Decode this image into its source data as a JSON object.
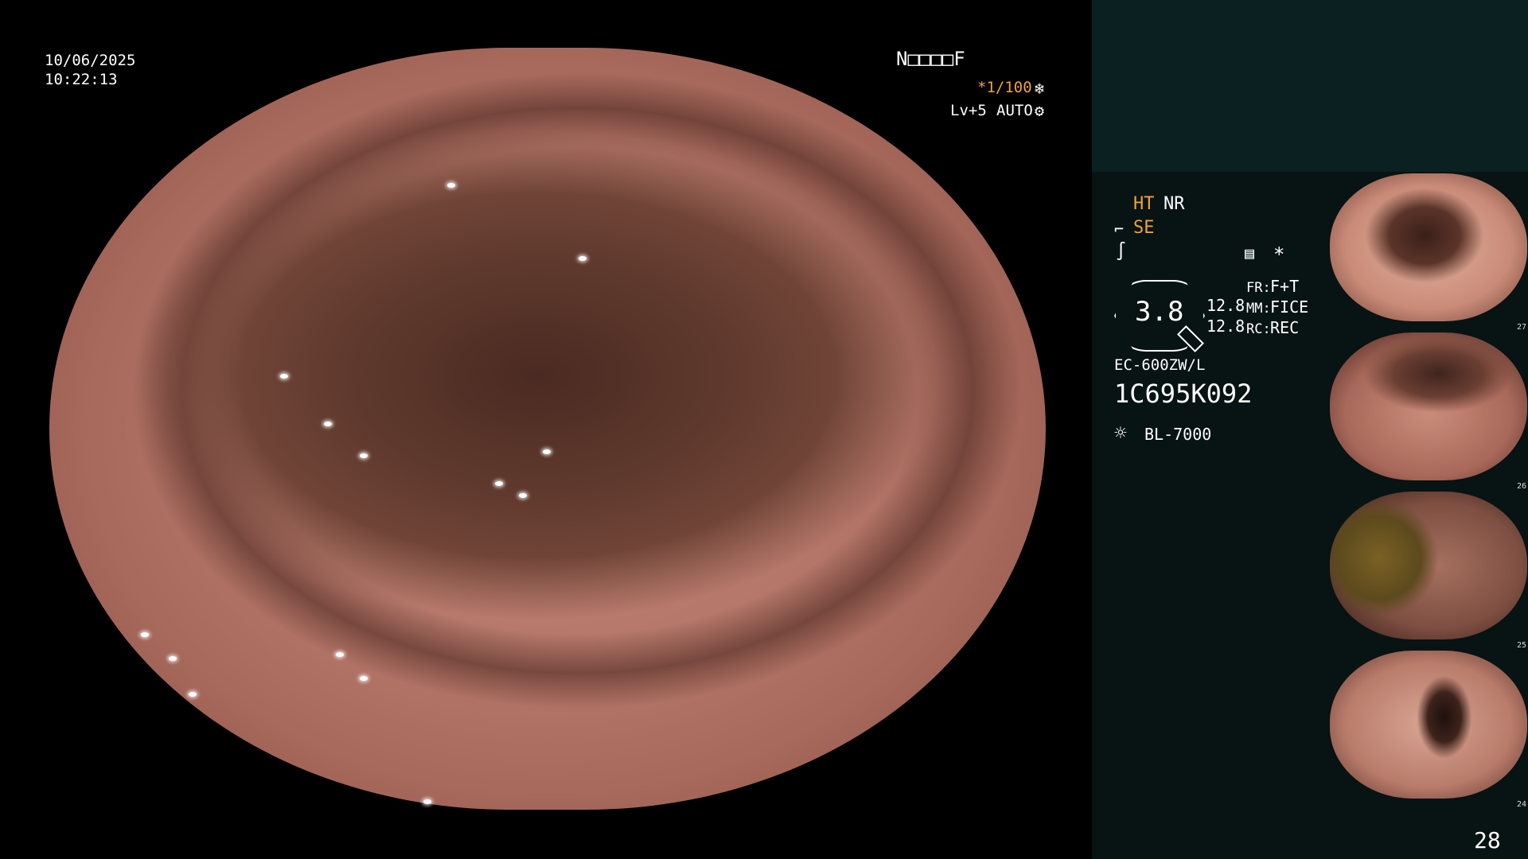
{
  "overlay": {
    "date": "10/06/2025",
    "time": "10:22:13",
    "patient_code": "N□□□□F",
    "shutter": "*1/100",
    "level": "Lv+5",
    "mode": "AUTO"
  },
  "panel": {
    "ht": "HT",
    "nr": "NR",
    "se": "SE",
    "scale_value": "3.8",
    "zoom1": "12.8",
    "zoom2": "12.8",
    "fr_label": "FR:",
    "fr_value": "F+T",
    "mm_label": "MM:",
    "mm_value": "FICE",
    "rc_label": "RC:",
    "rc_value": "REC",
    "scope_model": "EC-600ZW/L",
    "scope_serial": "1C695K092",
    "light_source": "BL-7000",
    "star": "*"
  },
  "thumbnails": [
    {
      "number": "27"
    },
    {
      "number": "26"
    },
    {
      "number": "25"
    },
    {
      "number": "24"
    }
  ],
  "image_counter": "28",
  "icons": {
    "shutter": "snowflake-icon",
    "mode": "gear-icon",
    "se": "scope-icon",
    "tilde": "curve-icon",
    "panel_list": "list-icon",
    "light": "sun-icon"
  }
}
